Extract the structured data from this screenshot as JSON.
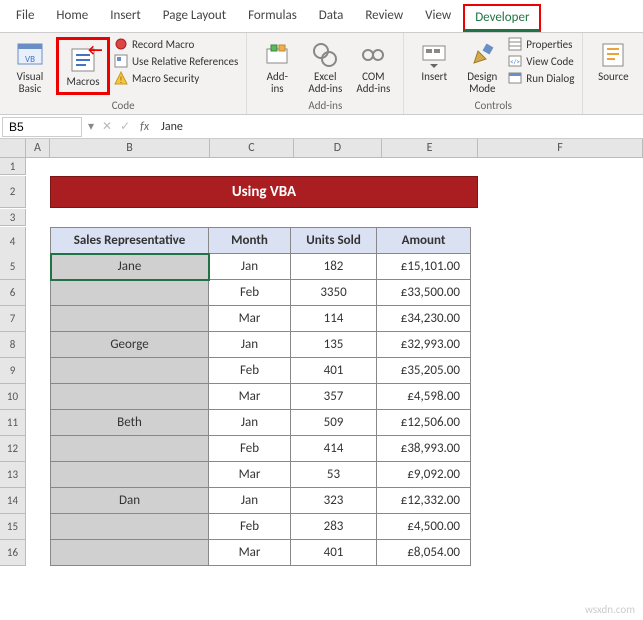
{
  "tabs": {
    "file": "File",
    "home": "Home",
    "insert": "Insert",
    "pageLayout": "Page Layout",
    "formulas": "Formulas",
    "data": "Data",
    "review": "Review",
    "view": "View",
    "developer": "Developer"
  },
  "ribbon": {
    "code": {
      "visualBasic": "Visual\nBasic",
      "macros": "Macros",
      "recordMacro": "Record Macro",
      "useRelRefs": "Use Relative References",
      "macroSecurity": "Macro Security",
      "groupLabel": "Code"
    },
    "addins": {
      "addins": "Add-\nins",
      "excelAddins": "Excel\nAdd-ins",
      "comAddins": "COM\nAdd-ins",
      "groupLabel": "Add-ins"
    },
    "controls": {
      "insert": "Insert",
      "designMode": "Design\nMode",
      "properties": "Properties",
      "viewCode": "View Code",
      "runDialog": "Run Dialog",
      "groupLabel": "Controls"
    },
    "xml": {
      "source": "Source"
    }
  },
  "nameBox": "B5",
  "formulaValue": "Jane",
  "cols": {
    "A": "A",
    "B": "B",
    "C": "C",
    "D": "D",
    "E": "E",
    "F": "F"
  },
  "banner": "Using VBA",
  "headers": {
    "rep": "Sales Representative",
    "month": "Month",
    "units": "Units Sold",
    "amount": "Amount"
  },
  "rows": [
    {
      "r": "5",
      "rep": "Jane",
      "month": "Jan",
      "units": "182",
      "amount": "£15,101.00"
    },
    {
      "r": "6",
      "rep": "",
      "month": "Feb",
      "units": "3350",
      "amount": "£33,500.00"
    },
    {
      "r": "7",
      "rep": "",
      "month": "Mar",
      "units": "114",
      "amount": "£34,230.00"
    },
    {
      "r": "8",
      "rep": "George",
      "month": "Jan",
      "units": "135",
      "amount": "£32,993.00"
    },
    {
      "r": "9",
      "rep": "",
      "month": "Feb",
      "units": "401",
      "amount": "£35,205.00"
    },
    {
      "r": "10",
      "rep": "",
      "month": "Mar",
      "units": "357",
      "amount": "£4,598.00"
    },
    {
      "r": "11",
      "rep": "Beth",
      "month": "Jan",
      "units": "509",
      "amount": "£12,506.00"
    },
    {
      "r": "12",
      "rep": "",
      "month": "Feb",
      "units": "414",
      "amount": "£38,993.00"
    },
    {
      "r": "13",
      "rep": "",
      "month": "Mar",
      "units": "53",
      "amount": "£9,092.00"
    },
    {
      "r": "14",
      "rep": "Dan",
      "month": "Jan",
      "units": "323",
      "amount": "£12,332.00"
    },
    {
      "r": "15",
      "rep": "",
      "month": "Feb",
      "units": "283",
      "amount": "£4,500.00"
    },
    {
      "r": "16",
      "rep": "",
      "month": "Mar",
      "units": "401",
      "amount": "£8,054.00"
    }
  ],
  "watermark": "wsxdn.com",
  "chart_data": {
    "type": "table",
    "title": "Using VBA",
    "columns": [
      "Sales Representative",
      "Month",
      "Units Sold",
      "Amount"
    ],
    "rows": [
      [
        "Jane",
        "Jan",
        182,
        15101.0
      ],
      [
        "Jane",
        "Feb",
        3350,
        33500.0
      ],
      [
        "Jane",
        "Mar",
        114,
        34230.0
      ],
      [
        "George",
        "Jan",
        135,
        32993.0
      ],
      [
        "George",
        "Feb",
        401,
        35205.0
      ],
      [
        "George",
        "Mar",
        357,
        4598.0
      ],
      [
        "Beth",
        "Jan",
        509,
        12506.0
      ],
      [
        "Beth",
        "Feb",
        414,
        38993.0
      ],
      [
        "Beth",
        "Mar",
        53,
        9092.0
      ],
      [
        "Dan",
        "Jan",
        323,
        12332.0
      ],
      [
        "Dan",
        "Feb",
        283,
        4500.0
      ],
      [
        "Dan",
        "Mar",
        401,
        8054.0
      ]
    ],
    "currency": "GBP"
  }
}
